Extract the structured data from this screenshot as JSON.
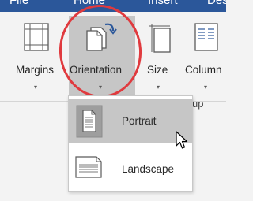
{
  "tabs": [
    "File",
    "Home",
    "Insert",
    "Des"
  ],
  "ribbon": {
    "buttons": [
      {
        "label": "Margins",
        "caret": "▾"
      },
      {
        "label": "Orientation",
        "caret": "▾"
      },
      {
        "label": "Size",
        "caret": "▾"
      },
      {
        "label": "Column",
        "caret": "▾"
      }
    ],
    "group_label": "up"
  },
  "orientation_menu": {
    "items": [
      {
        "label": "Portrait",
        "selected": true
      },
      {
        "label": "Landscape",
        "selected": false
      }
    ]
  },
  "colors": {
    "title_bar": "#2b579a",
    "annotation_circle": "#e03a3e",
    "accent_arrow": "#2b579a",
    "hover_highlight": "#c6c6c6"
  },
  "icons": [
    "margins-icon",
    "orientation-icon",
    "size-icon",
    "columns-icon",
    "portrait-icon",
    "landscape-icon",
    "mouse-pointer-icon"
  ]
}
